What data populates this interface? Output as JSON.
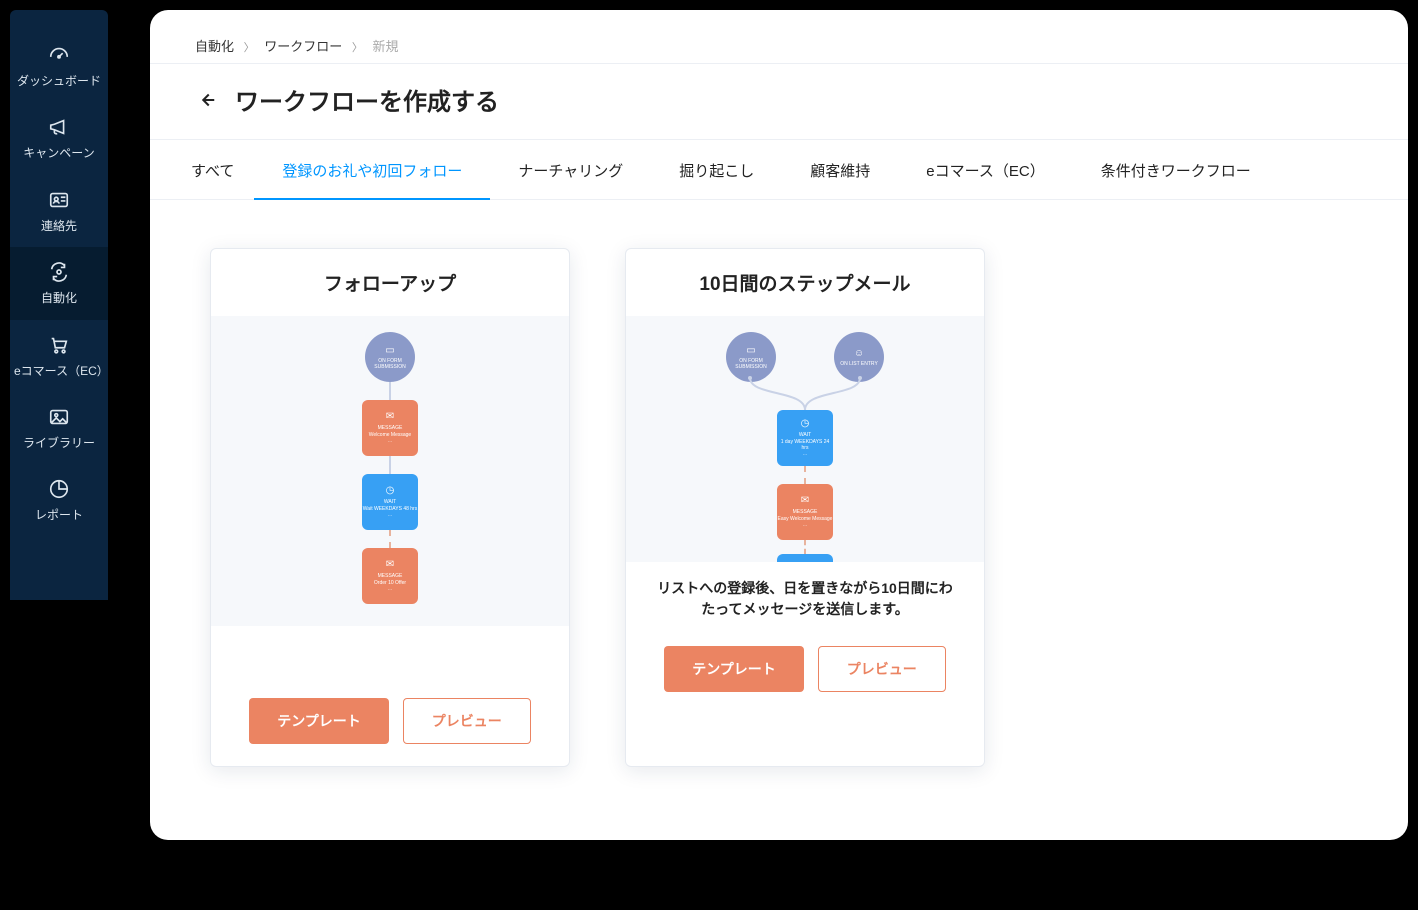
{
  "sidebar": {
    "items": [
      {
        "label": "ダッシュボード"
      },
      {
        "label": "キャンペーン"
      },
      {
        "label": "連絡先"
      },
      {
        "label": "自動化"
      },
      {
        "label": "eコマース（EC）"
      },
      {
        "label": "ライブラリー"
      },
      {
        "label": "レポート"
      }
    ]
  },
  "breadcrumbs": {
    "crumb1": "自動化",
    "crumb2": "ワークフロー",
    "crumb3": "新規"
  },
  "page_title": "ワークフローを作成する",
  "tabs": [
    {
      "label": "すべて"
    },
    {
      "label": "登録のお礼や初回フォロー"
    },
    {
      "label": "ナーチャリング"
    },
    {
      "label": "掘り起こし"
    },
    {
      "label": "顧客維持"
    },
    {
      "label": "eコマース（EC）"
    },
    {
      "label": "条件付きワークフロー"
    }
  ],
  "card1": {
    "title": "フォローアップ",
    "template_btn": "テンプレート",
    "preview_btn": "プレビュー"
  },
  "card2": {
    "title": "10日間のステップメール",
    "desc": "リストへの登録後、日を置きながら10日間にわたってメッセージを送信します。",
    "template_btn": "テンプレート",
    "preview_btn": "プレビュー"
  },
  "diagram1": {
    "n1": "ON FORM SUBMISSION",
    "n2_t": "MESSAGE",
    "n2": "Welcome Message",
    "n3_t": "WAIT",
    "n3": "Wait WEEKDAYS 48 hrs",
    "n4_t": "MESSAGE",
    "n4": "Order 10 Offer"
  },
  "diagram2": {
    "c1": "ON FORM SUBMISSION",
    "c2": "ON LIST ENTRY",
    "n1_t": "WAIT",
    "n1": "1 day WEEKDAYS 24 hrs",
    "n2_t": "MESSAGE",
    "n2": "Easy Welcome Message"
  }
}
